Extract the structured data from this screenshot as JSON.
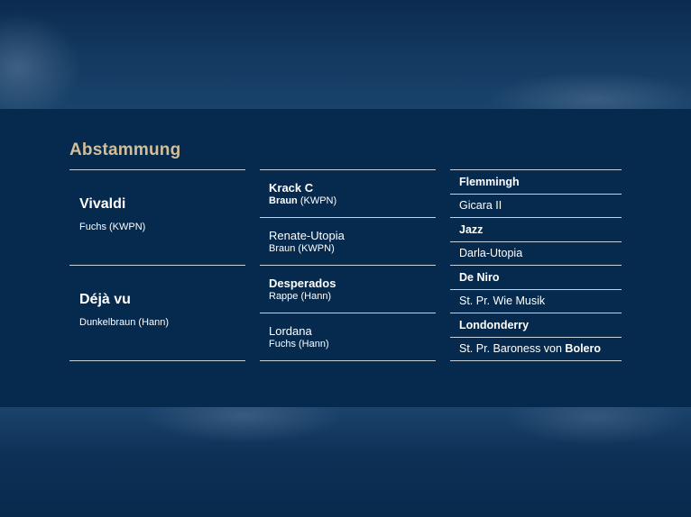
{
  "section": {
    "title": "Abstammung"
  },
  "parents": [
    {
      "name": "Vivaldi",
      "info": "Fuchs (KWPN)"
    },
    {
      "name": "Déjà vu",
      "info": "Dunkelbraun (Hann)"
    }
  ],
  "grandparents": [
    {
      "name": "Krack C",
      "info_bold": "Braun",
      "info_rest": " (KWPN)",
      "bold": true
    },
    {
      "name": "Renate-Utopia",
      "info_bold": "",
      "info_rest": "Braun (KWPN)",
      "bold": false
    },
    {
      "name": "Desperados",
      "info_bold": "",
      "info_rest": "Rappe (Hann)",
      "bold": true
    },
    {
      "name": "Lordana",
      "info_bold": "",
      "info_rest": "Fuchs (Hann)",
      "bold": false
    }
  ],
  "great_grandparents": [
    {
      "prefix": "",
      "name": "Flemmingh",
      "bold": true
    },
    {
      "prefix": "",
      "name": "Gicara II",
      "bold": false
    },
    {
      "prefix": "",
      "name": "Jazz",
      "bold": true
    },
    {
      "prefix": "",
      "name": "Darla-Utopia",
      "bold": false
    },
    {
      "prefix": "",
      "name": "De Niro",
      "bold": true
    },
    {
      "prefix": "",
      "name": "St. Pr. Wie Musik",
      "bold": false
    },
    {
      "prefix": "",
      "name": "Londonderry",
      "bold": true
    },
    {
      "prefix": "St. Pr. Baroness von ",
      "name": "Bolero",
      "bold": false
    }
  ]
}
